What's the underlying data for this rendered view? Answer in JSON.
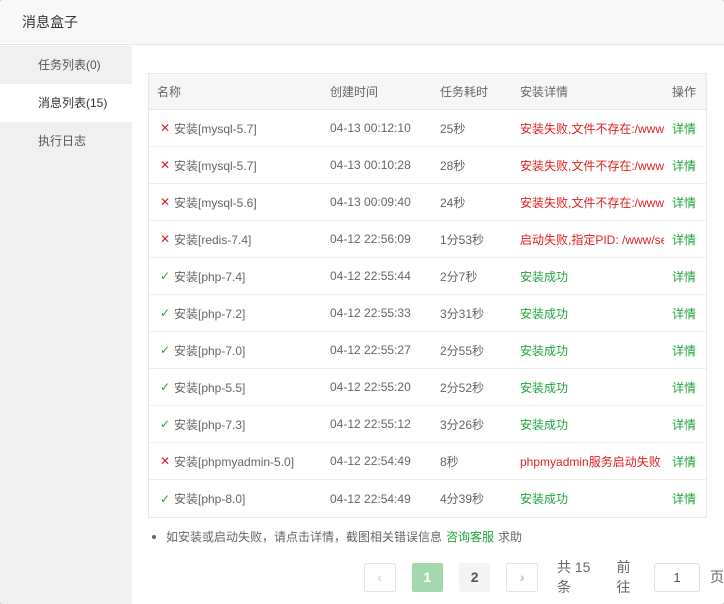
{
  "dialog": {
    "title": "消息盒子"
  },
  "sidebar": {
    "items": [
      {
        "label": "任务列表(0)"
      },
      {
        "label": "消息列表(15)"
      },
      {
        "label": "执行日志"
      }
    ]
  },
  "table": {
    "headers": [
      "名称",
      "创建时间",
      "任务耗时",
      "安装详情",
      "操作"
    ],
    "rows": [
      {
        "status": "fail",
        "icon": "✕",
        "name": "安装[mysql-5.7]",
        "time": "04-13 00:12:10",
        "duration": "25秒",
        "detail": "安装失败,文件不存在:/www/server/panel/install/mysql",
        "op": "详情"
      },
      {
        "status": "fail",
        "icon": "✕",
        "name": "安装[mysql-5.7]",
        "time": "04-13 00:10:28",
        "duration": "28秒",
        "detail": "安装失败,文件不存在:/www/server/panel/install/mysql",
        "op": "详情"
      },
      {
        "status": "fail",
        "icon": "✕",
        "name": "安装[mysql-5.6]",
        "time": "04-13 00:09:40",
        "duration": "24秒",
        "detail": "安装失败,文件不存在:/www/server/panel/install/mysql",
        "op": "详情"
      },
      {
        "status": "fail",
        "icon": "✕",
        "name": "安装[redis-7.4]",
        "time": "04-12 22:56:09",
        "duration": "1分53秒",
        "detail": "启动失败,指定PID: /www/server/redis/redis.pid",
        "op": "详情"
      },
      {
        "status": "ok",
        "icon": "✓",
        "name": "安装[php-7.4]",
        "time": "04-12 22:55:44",
        "duration": "2分7秒",
        "detail": "安装成功",
        "op": "详情"
      },
      {
        "status": "ok",
        "icon": "✓",
        "name": "安装[php-7.2]",
        "time": "04-12 22:55:33",
        "duration": "3分31秒",
        "detail": "安装成功",
        "op": "详情"
      },
      {
        "status": "ok",
        "icon": "✓",
        "name": "安装[php-7.0]",
        "time": "04-12 22:55:27",
        "duration": "2分55秒",
        "detail": "安装成功",
        "op": "详情"
      },
      {
        "status": "ok",
        "icon": "✓",
        "name": "安装[php-5.5]",
        "time": "04-12 22:55:20",
        "duration": "2分52秒",
        "detail": "安装成功",
        "op": "详情"
      },
      {
        "status": "ok",
        "icon": "✓",
        "name": "安装[php-7.3]",
        "time": "04-12 22:55:12",
        "duration": "3分26秒",
        "detail": "安装成功",
        "op": "详情"
      },
      {
        "status": "fail",
        "icon": "✕",
        "name": "安装[phpmyadmin-5.0]",
        "time": "04-12 22:54:49",
        "duration": "8秒",
        "detail": "phpmyadmin服务启动失败",
        "op": "详情"
      },
      {
        "status": "ok",
        "icon": "✓",
        "name": "安装[php-8.0]",
        "time": "04-12 22:54:49",
        "duration": "4分39秒",
        "detail": "安装成功",
        "op": "详情"
      }
    ]
  },
  "note": {
    "text": "如安装或启动失败，请点击详情，截图相关错误信息",
    "link": "咨询客服",
    "suffix": "求助"
  },
  "pagination": {
    "prev_icon": "‹",
    "next_icon": "›",
    "pages": [
      "1",
      "2"
    ],
    "current": "1",
    "total_text": "共 15 条",
    "goto_label": "前往",
    "goto_value": "1",
    "goto_suffix": "页"
  },
  "colors": {
    "success": "#20a53a",
    "error": "#e02020",
    "active_page": "#a3d9ad"
  }
}
